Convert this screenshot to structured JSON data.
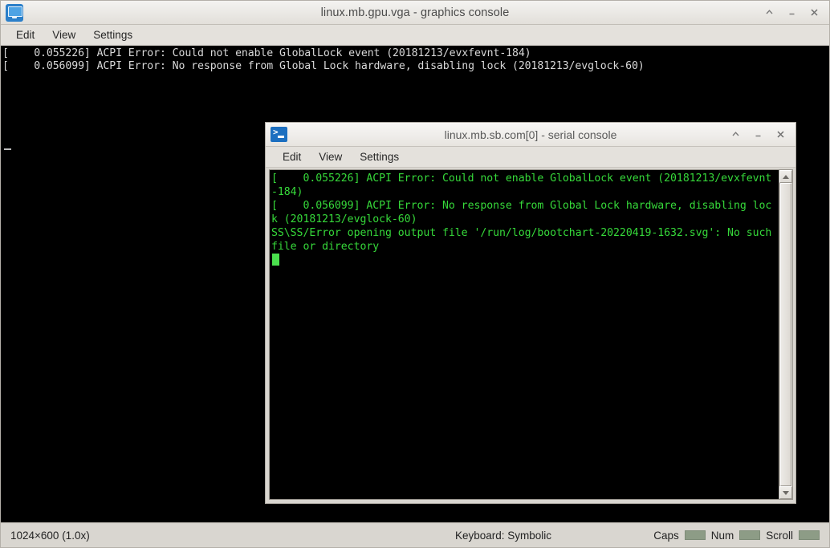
{
  "main_window": {
    "title": "linux.mb.gpu.vga - graphics console",
    "icon": "monitor-icon",
    "menu": [
      {
        "label": "Edit"
      },
      {
        "label": "View"
      },
      {
        "label": "Settings"
      }
    ],
    "controls": [
      {
        "name": "shade",
        "glyph": "˄"
      },
      {
        "name": "minimize",
        "glyph": "–"
      },
      {
        "name": "close",
        "glyph": "×"
      }
    ],
    "console_text": "[    0.055226] ACPI Error: Could not enable GlobalLock event (20181213/evxfevnt-184)\n[    0.056099] ACPI Error: No response from Global Lock hardware, disabling lock (20181213/evglock-60)",
    "console_fg": "#d8d8d8",
    "console_bg": "#000000"
  },
  "status_bar": {
    "resolution": "1024×600 (1.0x)",
    "keyboard": "Keyboard: Symbolic",
    "leds": [
      {
        "label": "Caps",
        "active": false
      },
      {
        "label": "Num",
        "active": false
      },
      {
        "label": "Scroll",
        "active": false
      }
    ],
    "led_color": "#8d9c86"
  },
  "serial_window": {
    "title": "linux.mb.sb.com[0] - serial console",
    "icon": "terminal-prompt-icon",
    "menu": [
      {
        "label": "Edit"
      },
      {
        "label": "View"
      },
      {
        "label": "Settings"
      }
    ],
    "controls": [
      {
        "name": "shade",
        "glyph": "˄"
      },
      {
        "name": "minimize",
        "glyph": "–"
      },
      {
        "name": "close",
        "glyph": "×"
      }
    ],
    "console_text": "[    0.055226] ACPI Error: Could not enable GlobalLock event (20181213/evxfevnt-184)\n[    0.056099] ACPI Error: No response from Global Lock hardware, disabling lock (20181213/evglock-60)\nSS\\SS/Error opening output file '/run/log/bootchart-20220419-1632.svg': No such file or directory",
    "console_fg": "#36d93a",
    "console_bg": "#000000",
    "scrollbar": {
      "up_arrow": "▲",
      "down_arrow": "▼"
    }
  }
}
